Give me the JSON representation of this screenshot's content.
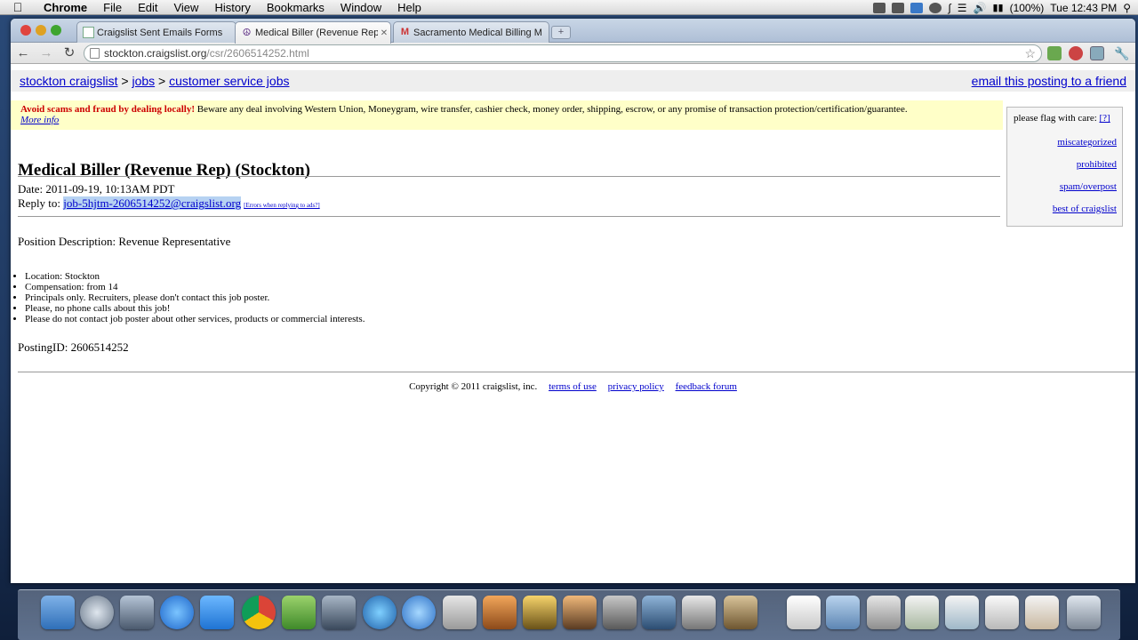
{
  "menubar": {
    "app": "Chrome",
    "items": [
      "File",
      "Edit",
      "View",
      "History",
      "Bookmarks",
      "Window",
      "Help"
    ],
    "battery": "(100%)",
    "clock": "Tue 12:43 PM"
  },
  "tabs": [
    {
      "label": "Craigslist Sent Emails Forms"
    },
    {
      "label": "Medical Biller (Revenue Rep)"
    },
    {
      "label": "Sacramento Medical Billing M"
    }
  ],
  "address": {
    "host": "stockton.craigslist.org",
    "path": "/csr/2606514252.html"
  },
  "breadcrumb": {
    "site": "stockton craigslist",
    "sep1": ">",
    "jobs": "jobs",
    "sep2": ">",
    "category": "customer service jobs",
    "email_friend": "email this posting to a friend"
  },
  "scam": {
    "headline": "Avoid scams and fraud by dealing locally!",
    "body": " Beware any deal involving Western Union, Moneygram, wire transfer, cashier check, money order, shipping, escrow, or any promise of transaction protection/certification/guarantee.",
    "more": "More info"
  },
  "flag": {
    "title": "please flag with care:",
    "help": "[?]",
    "links": [
      "miscategorized",
      "prohibited",
      "spam/overpost",
      "best of craigslist"
    ]
  },
  "posting": {
    "title": "Medical Biller (Revenue Rep) (Stockton)",
    "date": "Date: 2011-09-19, 10:13AM PDT",
    "reply_label": "Reply to: ",
    "reply_email": "job-5hjtm-2606514252@craigslist.org",
    "reply_errors": "[Errors when replying to ads?]",
    "position": "Position Description: Revenue Representative",
    "bullets": [
      "Location: Stockton",
      "Compensation: from 14",
      "Principals only. Recruiters, please don't contact this job poster.",
      "Please, no phone calls about this job!",
      "Please do not contact job poster about other services, products or commercial interests."
    ],
    "posting_id": "PostingID: 2606514252"
  },
  "footer": {
    "copyright": "Copyright © 2011 craigslist, inc.",
    "terms": "terms of use",
    "privacy": "privacy policy",
    "feedback": "feedback forum"
  },
  "colors": {
    "link": "#0000cc",
    "scam_bg": "#ffffc8",
    "scam_head": "#cc0000",
    "breadcrumb_bg": "#eeeeee"
  }
}
